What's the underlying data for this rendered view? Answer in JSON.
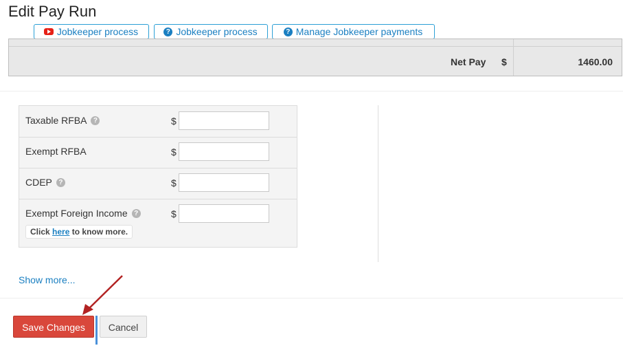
{
  "page": {
    "title": "Edit Pay Run"
  },
  "toolbar": {
    "buttons": [
      {
        "label": "Jobkeeper process",
        "icon": "youtube-icon"
      },
      {
        "label": "Jobkeeper process",
        "icon": "help-circle-icon"
      },
      {
        "label": "Manage Jobkeeper payments",
        "icon": "help-circle-icon"
      }
    ]
  },
  "summary": {
    "net_pay_label": "Net Pay",
    "currency": "$",
    "net_pay_value": "1460.00"
  },
  "rfba": {
    "rows": [
      {
        "label": "Taxable RFBA",
        "has_help": true,
        "currency": "$",
        "value": ""
      },
      {
        "label": "Exempt RFBA",
        "has_help": false,
        "currency": "$",
        "value": ""
      },
      {
        "label": "CDEP",
        "has_help": true,
        "currency": "$",
        "value": ""
      },
      {
        "label": "Exempt Foreign Income",
        "has_help": true,
        "currency": "$",
        "value": ""
      }
    ],
    "note": {
      "prefix": "Click",
      "link": "here",
      "suffix": "to know more."
    }
  },
  "show_more": "Show more...",
  "actions": {
    "save_label": "Save Changes",
    "cancel_label": "Cancel"
  },
  "colors": {
    "accent": "#1a7fc1",
    "save": "#d9473b",
    "arrow": "#b22222"
  }
}
